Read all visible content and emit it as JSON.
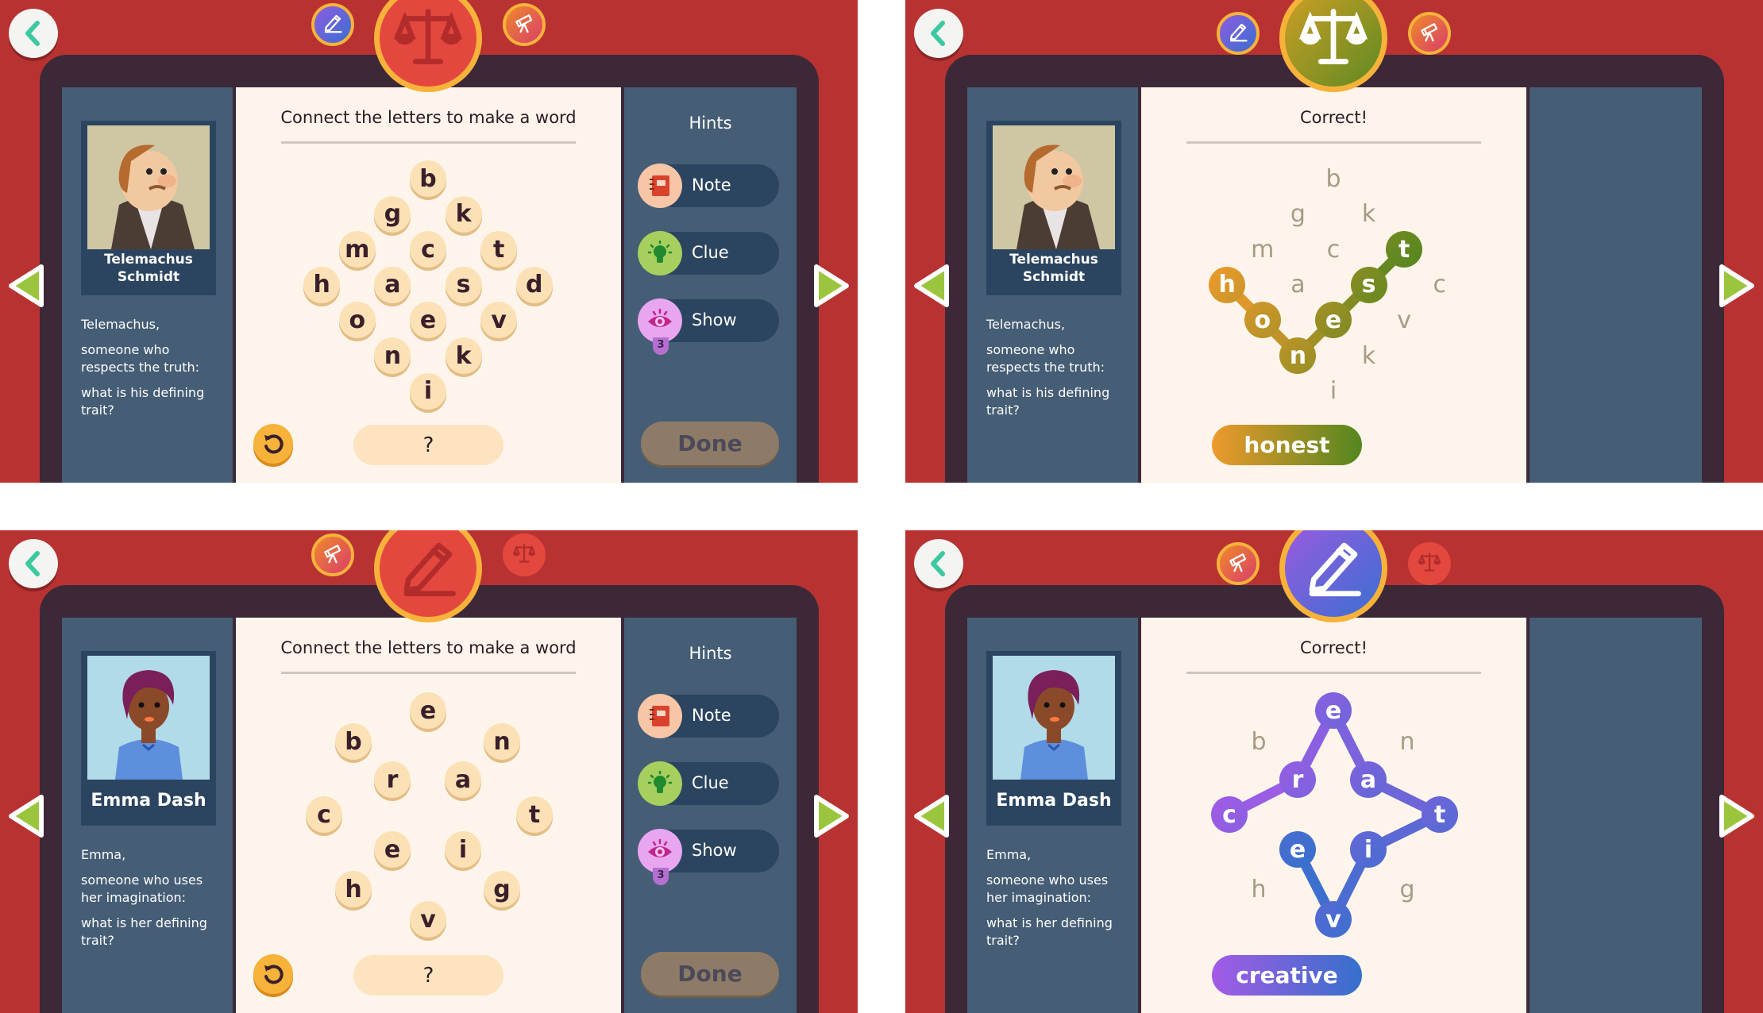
{
  "colors": {
    "background": "#b83232",
    "frame": "#3d2838",
    "side_panel": "#455d75",
    "content": "#fdf5ec",
    "tile": "#fbe1b5",
    "faded_letter": "#a89a85",
    "honest_start": "#ee9a2c",
    "honest_end": "#54861f",
    "creative_start": "#a35be6",
    "creative_end": "#3570cc"
  },
  "panels": [
    {
      "state": "puzzle",
      "top_icons": [
        "pencil-icon",
        "scale-icon",
        "telescope-icon"
      ],
      "active_theme": "red",
      "character": {
        "name": "Telemachus Schmidt",
        "portrait": "telemachus"
      },
      "prompt": [
        "Telemachus,",
        "someone who respects the truth:",
        "what is his defining trait?"
      ],
      "title": "Connect the letters to make a word",
      "letters": [
        "b",
        "g",
        "k",
        "m",
        "c",
        "t",
        "h",
        "a",
        "s",
        "d",
        "o",
        "e",
        "v",
        "n",
        "k",
        "i"
      ],
      "selected": [],
      "answer": "?",
      "hints": {
        "label": "Hints",
        "items": [
          {
            "label": "Note",
            "icon": "notebook-icon"
          },
          {
            "label": "Clue",
            "icon": "lightbulb-icon"
          },
          {
            "label": "Show",
            "icon": "eye-icon",
            "count": "3"
          }
        ]
      },
      "done": "Done"
    },
    {
      "state": "solved",
      "top_icons": [
        "pencil-icon",
        "scale-icon",
        "telescope-icon"
      ],
      "active_theme": "honest",
      "character": {
        "name": "Telemachus Schmidt",
        "portrait": "telemachus"
      },
      "prompt": [
        "Telemachus,",
        "someone who respects the truth:",
        "what is his defining trait?"
      ],
      "title": "Correct!",
      "letters": [
        "b",
        "g",
        "k",
        "m",
        "c",
        "t",
        "h",
        "a",
        "s",
        "c",
        "o",
        "e",
        "v",
        "n",
        "k",
        "i"
      ],
      "selected": [
        6,
        10,
        13,
        11,
        8,
        5
      ],
      "answer": "honest"
    },
    {
      "state": "puzzle",
      "top_icons": [
        "telescope-icon",
        "pencil-icon",
        "scale-icon"
      ],
      "active_theme": "red",
      "character": {
        "name": "Emma Dash",
        "portrait": "emma"
      },
      "prompt": [
        "Emma,",
        "someone who uses her imagination:",
        "what is her defining trait?"
      ],
      "title": "Connect the letters to make a word",
      "letters": [
        "e",
        "b",
        "n",
        "r",
        "a",
        "c",
        "t",
        "e",
        "i",
        "h",
        "g",
        "v"
      ],
      "selected": [],
      "answer": "?",
      "hints": {
        "label": "Hints",
        "items": [
          {
            "label": "Note",
            "icon": "notebook-icon"
          },
          {
            "label": "Clue",
            "icon": "lightbulb-icon"
          },
          {
            "label": "Show",
            "icon": "eye-icon",
            "count": "3"
          }
        ]
      },
      "done": "Done"
    },
    {
      "state": "solved",
      "top_icons": [
        "telescope-icon",
        "pencil-icon",
        "scale-icon"
      ],
      "active_theme": "creative",
      "character": {
        "name": "Emma Dash",
        "portrait": "emma"
      },
      "prompt": [
        "Emma,",
        "someone who uses her imagination:",
        "what is her defining trait?"
      ],
      "title": "Correct!",
      "letters": [
        "e",
        "b",
        "n",
        "r",
        "a",
        "c",
        "t",
        "e",
        "i",
        "h",
        "g",
        "v"
      ],
      "selected": [
        5,
        3,
        0,
        4,
        6,
        8,
        11,
        7
      ],
      "answer": "creative"
    }
  ]
}
